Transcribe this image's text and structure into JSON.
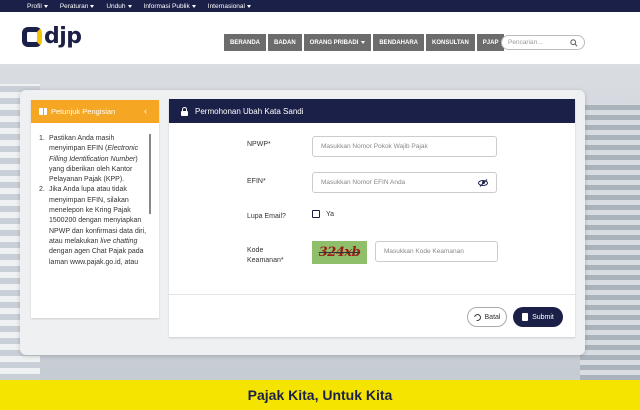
{
  "topbar": {
    "items": [
      {
        "label": "Profil"
      },
      {
        "label": "Peraturan"
      },
      {
        "label": "Unduh"
      },
      {
        "label": "Informasi Publik"
      },
      {
        "label": "Internasional"
      }
    ]
  },
  "header": {
    "logo_text": "djp",
    "nav": [
      {
        "label": "BERANDA"
      },
      {
        "label": "BADAN"
      },
      {
        "label": "ORANG PRIBADI"
      },
      {
        "label": "BENDAHARA"
      },
      {
        "label": "KONSULTAN"
      },
      {
        "label": "PJAP"
      }
    ],
    "search_placeholder": "Pencarian..."
  },
  "guide": {
    "title": "Petunjuk Pengisian",
    "items": [
      {
        "num": "1.",
        "html": "Pastikan Anda masih menyimpan EFIN (<i>Electronic Filling Identification Number</i>) yang diberikan oleh Kantor Pelayanan Pajak (KPP)."
      },
      {
        "num": "2.",
        "html": "Jika Anda lupa atau tidak menyimpan EFIN, silakan menelepon ke Kring Pajak 1500200 dengan menyiapkan NPWP dan konfirmasi data diri, atau melakukan <i>live chatting</i> dengan agen Chat Pajak pada laman www.pajak.go.id, atau"
      }
    ]
  },
  "form": {
    "title": "Permohonan Ubah Kata Sandi",
    "npwp_label": "NPWP*",
    "npwp_placeholder": "Masukkan Nomor Pokok Wajib Pajak",
    "efin_label": "EFIN*",
    "efin_placeholder": "Masukkan Nomor EFIN Anda",
    "lupa_email_label": "Lupa Email?",
    "lupa_email_option": "Ya",
    "kode_label_1": "Kode",
    "kode_label_2": "Keamanan*",
    "captcha_text": "324xb",
    "kode_placeholder": "Masukkan Kode Keamanan",
    "batal_label": "Batal",
    "submit_label": "Submit"
  },
  "footer": {
    "tagline": "Pajak Kita, Untuk Kita"
  },
  "colors": {
    "navy": "#1b2048",
    "orange": "#f5a623",
    "yellow": "#f5e400"
  }
}
